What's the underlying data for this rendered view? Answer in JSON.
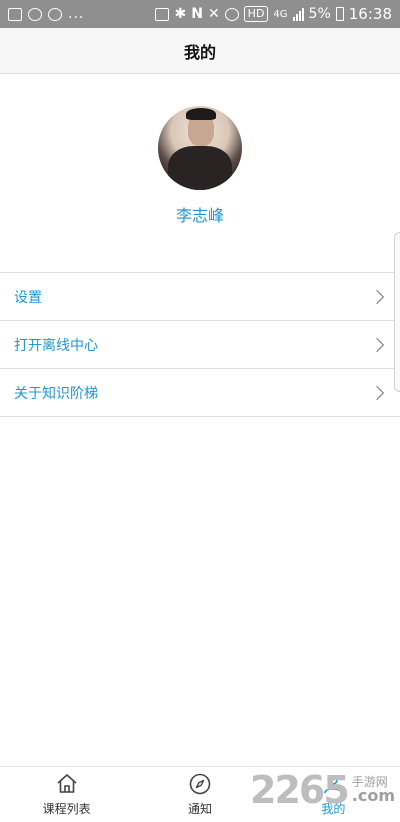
{
  "status_bar": {
    "dots": "...",
    "hd": "HD",
    "network": "4G",
    "battery": "5%",
    "time": "16:38"
  },
  "header": {
    "title": "我的"
  },
  "profile": {
    "name": "李志峰"
  },
  "menu": {
    "items": [
      {
        "label": "设置"
      },
      {
        "label": "打开离线中心"
      },
      {
        "label": "关于知识阶梯"
      }
    ]
  },
  "tabbar": {
    "tabs": [
      {
        "label": "课程列表",
        "icon": "home-icon",
        "active": false
      },
      {
        "label": "通知",
        "icon": "compass-icon",
        "active": false
      },
      {
        "label": "我的",
        "icon": "person-icon",
        "active": true
      }
    ]
  },
  "watermark": {
    "number": "2265",
    "site_cn": "手游网",
    "site_com": ".com"
  },
  "colors": {
    "accent": "#2196d3",
    "statusbar": "#8f8f8f"
  }
}
